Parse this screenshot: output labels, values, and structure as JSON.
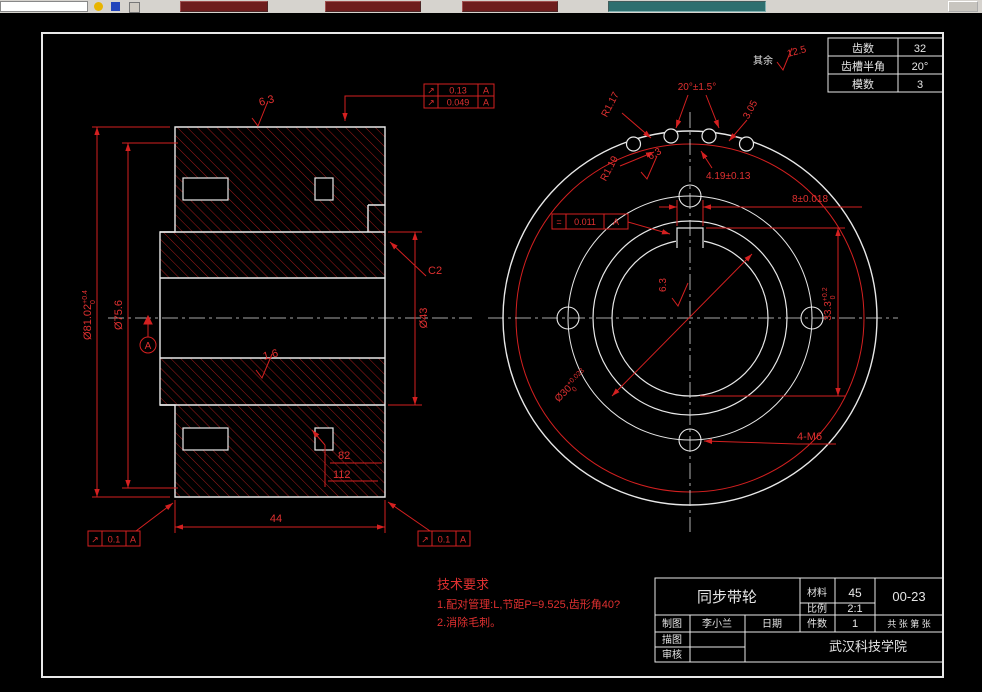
{
  "param_table": {
    "rows": [
      {
        "label": "齿数",
        "value": "32"
      },
      {
        "label": "齿槽半角",
        "value": "20°"
      },
      {
        "label": "模数",
        "value": "3"
      }
    ]
  },
  "title_block": {
    "part_name": "同步带轮",
    "material_label": "材料",
    "material": "45",
    "scale_label": "比例",
    "scale": "2:1",
    "drawing_no": "00-23",
    "draw_label": "制图",
    "drafter": "李小兰",
    "date_label": "日期",
    "qty_label": "件数",
    "qty": "1",
    "sheet_info": "共 张 第 张",
    "trace_label": "描图",
    "check_label": "审核",
    "school": "武汉科技学院"
  },
  "tech": {
    "title": "技术要求",
    "l1": "1.配对管理:L,节距P=9.525,齿形角40?",
    "l2": "2.消除毛刺。"
  },
  "dims": {
    "od": {
      "val": "Ø81.02",
      "sup": "+0.4",
      "sub": "0"
    },
    "d756": "Ø75.6",
    "d43": "Ø43",
    "w44": "44",
    "c2": "C2",
    "r16": "1.6",
    "r63_top": "6.3",
    "datum": "A",
    "tol_top1": {
      "sym": "↗",
      "val": "0.13",
      "ref": "A"
    },
    "tol_top2": {
      "sym": "↗",
      "val": "0.049",
      "ref": "A"
    },
    "tol_bl": {
      "sym": "↗",
      "val": "0.1",
      "ref": "A"
    },
    "tol_br": {
      "sym": "↗",
      "val": "0.1",
      "ref": "A"
    },
    "note1": "82",
    "note2": "112",
    "rest_label": "其余",
    "rest_val": "12.5",
    "angle": "20°±1.5°",
    "r117": "R1.17",
    "r119": "R1.19",
    "t305": "3.05",
    "t419": "4.19±0.13",
    "s63_tooth": "6.3",
    "s63_key": "6.3",
    "kw": "8±0.018",
    "kh": {
      "val": "33.3",
      "sup": "+0.2",
      "sub": "0"
    },
    "bore": {
      "val": "Ø30",
      "sup": "+0.023",
      "sub": "0"
    },
    "m6": "4-M6",
    "tol_key": {
      "sym": "=",
      "val": "0.011",
      "ref": "A"
    }
  }
}
